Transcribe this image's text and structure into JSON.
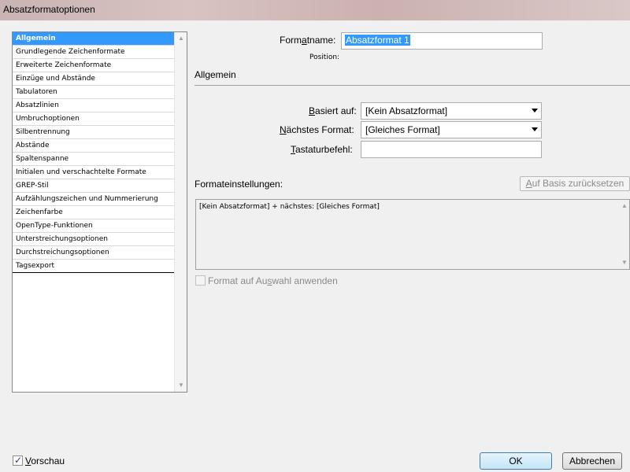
{
  "window": {
    "title": "Absatzformatoptionen"
  },
  "sidebar": {
    "items": [
      {
        "label": "Allgemein"
      },
      {
        "label": "Grundlegende Zeichenformate"
      },
      {
        "label": "Erweiterte Zeichenformate"
      },
      {
        "label": "Einzüge und Abstände"
      },
      {
        "label": "Tabulatoren"
      },
      {
        "label": "Absatzlinien"
      },
      {
        "label": "Umbruchoptionen"
      },
      {
        "label": "Silbentrennung"
      },
      {
        "label": "Abstände"
      },
      {
        "label": "Spaltenspanne"
      },
      {
        "label": "Initialen und verschachtelte Formate"
      },
      {
        "label": "GREP-Stil"
      },
      {
        "label": "Aufzählungszeichen und Nummerierung"
      },
      {
        "label": "Zeichenfarbe"
      },
      {
        "label": "OpenType-Funktionen"
      },
      {
        "label": "Unterstreichungsoptionen"
      },
      {
        "label": "Durchstreichungsoptionen"
      },
      {
        "label": "Tagsexport"
      }
    ],
    "selected_index": 0,
    "scroll_up_icon": "arrow-up-icon",
    "scroll_down_icon": "arrow-down-icon"
  },
  "main": {
    "formatname_label_pre": "Form",
    "formatname_label_ul": "a",
    "formatname_label_post": "tname:",
    "formatname_value": "Absatzformat 1",
    "position_label": "Position:",
    "section_title": "Allgemein",
    "basiert_label_ul": "B",
    "basiert_label_post": "asiert auf:",
    "basiert_value": "[Kein Absatzformat]",
    "naechstes_label_ul": "N",
    "naechstes_label_post": "ächstes Format:",
    "naechstes_value": "[Gleiches Format]",
    "tastatur_label_ul": "T",
    "tastatur_label_post": "astaturbefehl:",
    "tastatur_value": "",
    "settings_label": "Formateinstellungen:",
    "reset_button_ul": "A",
    "reset_button_post": "uf Basis zurücksetzen",
    "settings_text": "[Kein Absatzformat] + nächstes: [Gleiches Format]",
    "apply_label_pre": "Format auf Au",
    "apply_label_ul": "s",
    "apply_label_post": "wahl anwenden",
    "apply_checked": false
  },
  "footer": {
    "preview_label_ul": "V",
    "preview_label_post": "orschau",
    "preview_checked": true,
    "ok_label": "OK",
    "cancel_label": "Abbrechen"
  }
}
